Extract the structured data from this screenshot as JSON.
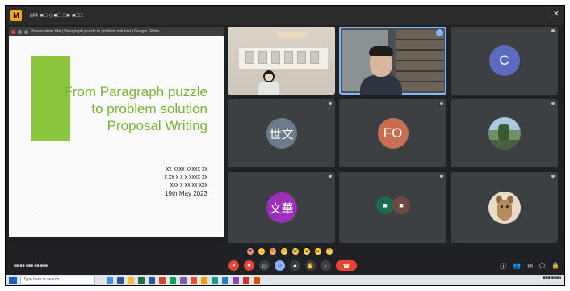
{
  "window": {
    "app_icon_glyph": "M",
    "title": "M4 ■□ ◇■□ □■ ■□□"
  },
  "share": {
    "url_text": "Presentation title | Paragraph puzzle to problem solution | Google Slides",
    "slide": {
      "title_lines": [
        "From Paragraph puzzle",
        "to problem solution",
        "Proposal Writing"
      ],
      "author_lines": [
        "xx xxxx xxxxx xx",
        "x xx x x x xxxx xx",
        "xxx x xx xx xxx"
      ],
      "date": "19th May 2023",
      "accent_color": "#8cc63f"
    }
  },
  "participants": [
    {
      "id": "classroom",
      "name": "",
      "type": "video"
    },
    {
      "id": "host",
      "name": "",
      "type": "video"
    },
    {
      "id": "c",
      "name": "",
      "initials": "C",
      "color": "#5c6bc0"
    },
    {
      "id": "p4",
      "name": "",
      "initials": "世文",
      "color": "#6c7c8a"
    },
    {
      "id": "p5",
      "name": "",
      "initials": "FO",
      "color": "#c86f52"
    },
    {
      "id": "p6",
      "name": "",
      "type": "image",
      "icon": "landscape-avatar"
    },
    {
      "id": "p7",
      "name": "",
      "initials": "文華",
      "color": "#9c2fb8"
    },
    {
      "id": "p8",
      "name": "",
      "type": "group",
      "minis": [
        "■",
        "■"
      ]
    },
    {
      "id": "p9",
      "name": "",
      "type": "image",
      "icon": "animal-avatar"
    }
  ],
  "reactions": [
    "♥",
    "👍",
    "🎉",
    "👏",
    "😂",
    "😮",
    "😢",
    "🤔"
  ],
  "controls": {
    "meeting_info": "■■ ■■ ■■■ ■■ ■■■",
    "end_call_icon": "end-call-icon"
  },
  "taskbar": {
    "search_placeholder": "Type here to search",
    "tray_text": "■■■ ■■■■"
  }
}
